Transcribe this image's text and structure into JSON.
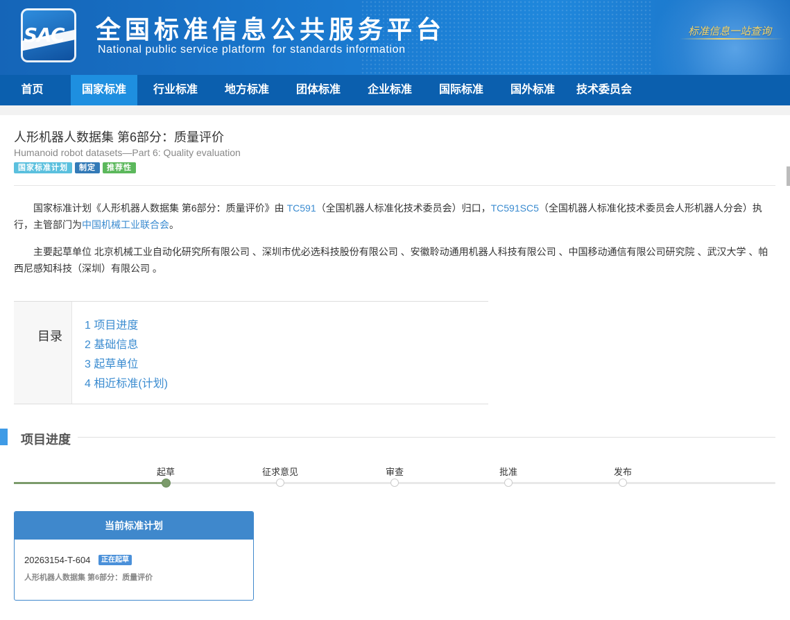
{
  "header": {
    "logo_text": "SAC",
    "title_cn": "全国标准信息公共服务平台",
    "title_en": "National public service platform  for standards information",
    "slogan": "标准信息一站查询"
  },
  "nav": {
    "items": [
      {
        "label": "首页"
      },
      {
        "label": "国家标准"
      },
      {
        "label": "行业标准"
      },
      {
        "label": "地方标准"
      },
      {
        "label": "团体标准"
      },
      {
        "label": "企业标准"
      },
      {
        "label": "国际标准"
      },
      {
        "label": "国外标准"
      },
      {
        "label": "技术委员会"
      }
    ],
    "active": "国家标准"
  },
  "document": {
    "title": "人形机器人数据集 第6部分：质量评价",
    "subtitle": "Humanoid robot datasets—Part 6: Quality evaluation",
    "tags": [
      "国家标准计划",
      "制定",
      "推荐性"
    ]
  },
  "intro": {
    "p1_prefix": "国家标准计划《人形机器人数据集 第6部分：质量评价》由 ",
    "tc_link": "TC591",
    "p1_mid1": "（全国机器人标准化技术委员会）归口，",
    "sc_link": "TC591SC5",
    "p1_mid2": "（全国机器人标准化技术委员会人形机器人分会）执行，主管部门为",
    "dept_link": "中国机械工业联合会",
    "p1_end": "。",
    "p2": "主要起草单位 北京机械工业自动化研究所有限公司 、深圳市优必选科技股份有限公司 、安徽聆动通用机器人科技有限公司 、中国移动通信有限公司研究院 、武汉大学 、帕西尼感知科技（深圳）有限公司 。"
  },
  "toc": {
    "label": "目录",
    "items": [
      "1  项目进度",
      "2  基础信息",
      "3  起草单位",
      "4  相近标准(计划)"
    ]
  },
  "progress": {
    "section_title": "项目进度",
    "steps": [
      "起草",
      "征求意见",
      "审查",
      "批准",
      "发布"
    ],
    "current_step": "起草"
  },
  "plan_card": {
    "header": "当前标准计划",
    "code": "20263154-T-604",
    "status": "正在起草",
    "name": "人形机器人数据集 第6部分：质量评价"
  },
  "colors": {
    "nav_bg": "#0b5fae",
    "nav_active": "#1e8fe0",
    "link": "#3a8bd0",
    "progress_done": "#7b9b6b",
    "card_accent": "#3f88cc"
  }
}
